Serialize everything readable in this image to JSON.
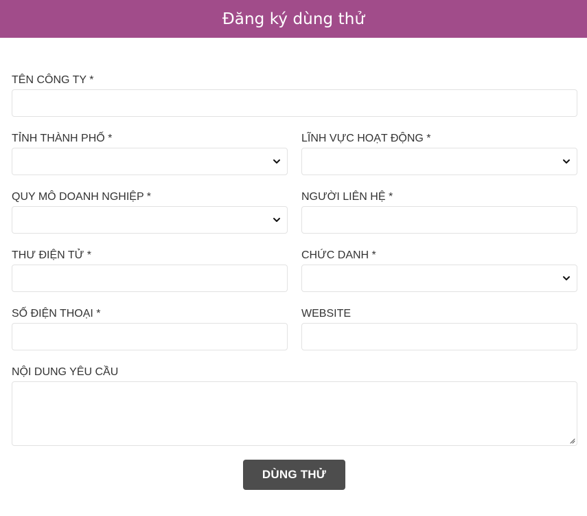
{
  "header": {
    "title": "Đăng ký dùng thử"
  },
  "form": {
    "company_name": {
      "label": "TÊN CÔNG TY *",
      "value": ""
    },
    "city": {
      "label": "TỈNH THÀNH PHỐ *",
      "value": ""
    },
    "industry": {
      "label": "LĨNH VỰC HOẠT ĐỘNG *",
      "value": ""
    },
    "company_size": {
      "label": "QUY MÔ DOANH NGHIỆP *",
      "value": ""
    },
    "contact_person": {
      "label": "NGƯỜI LIÊN HỆ *",
      "value": ""
    },
    "email": {
      "label": "THƯ ĐIỆN TỬ *",
      "value": ""
    },
    "job_title": {
      "label": "CHỨC DANH *",
      "value": ""
    },
    "phone": {
      "label": "SỐ ĐIỆN THOẠI *",
      "value": ""
    },
    "website": {
      "label": "WEBSITE",
      "value": ""
    },
    "request": {
      "label": "NỘI DUNG YÊU CẦU",
      "value": ""
    },
    "submit_label": "DÙNG THỬ"
  },
  "icons": {
    "select_arrow": "chevron-down-icon",
    "resize_handle": "resize-grip-icon"
  },
  "colors": {
    "header_bg": "#a14c8a",
    "header_text": "#ffffff",
    "button_bg": "#4d4d4d",
    "button_text": "#ffffff",
    "field_border": "#e2e2e2",
    "label_text": "#333333"
  }
}
